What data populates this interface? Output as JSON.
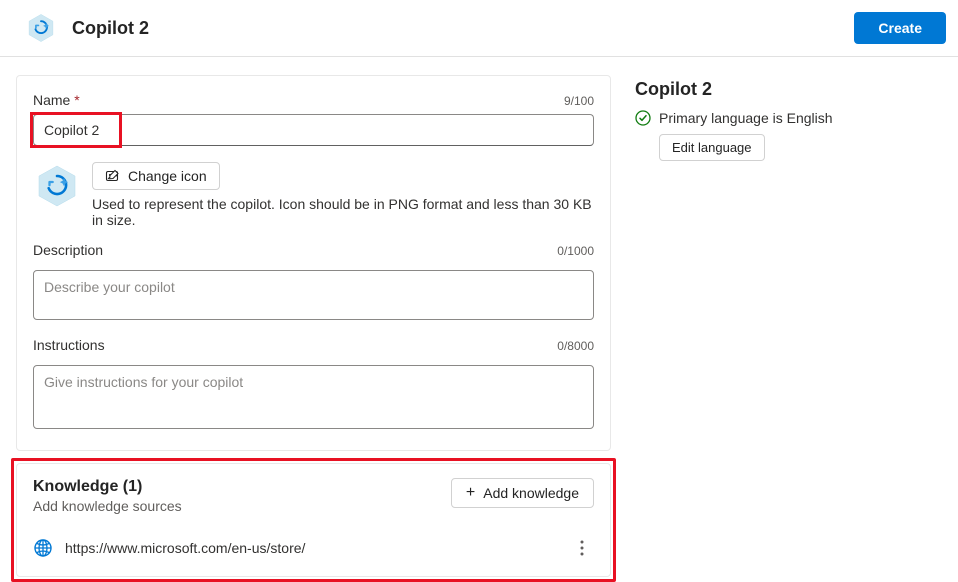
{
  "header": {
    "title": "Copilot 2",
    "create_label": "Create"
  },
  "form": {
    "name": {
      "label": "Name",
      "value": "Copilot 2",
      "counter": "9/100"
    },
    "icon": {
      "change_label": "Change icon",
      "hint": "Used to represent the copilot. Icon should be in PNG format and less than 30 KB in size."
    },
    "description": {
      "label": "Description",
      "placeholder": "Describe your copilot",
      "counter": "0/1000"
    },
    "instructions": {
      "label": "Instructions",
      "placeholder": "Give instructions for your copilot",
      "counter": "0/8000"
    }
  },
  "knowledge": {
    "title": "Knowledge (1)",
    "subtitle": "Add knowledge sources",
    "add_label": "Add knowledge",
    "items": [
      {
        "url": "https://www.microsoft.com/en-us/store/"
      }
    ]
  },
  "side": {
    "title": "Copilot 2",
    "language_status": "Primary language is English",
    "edit_language_label": "Edit language"
  }
}
